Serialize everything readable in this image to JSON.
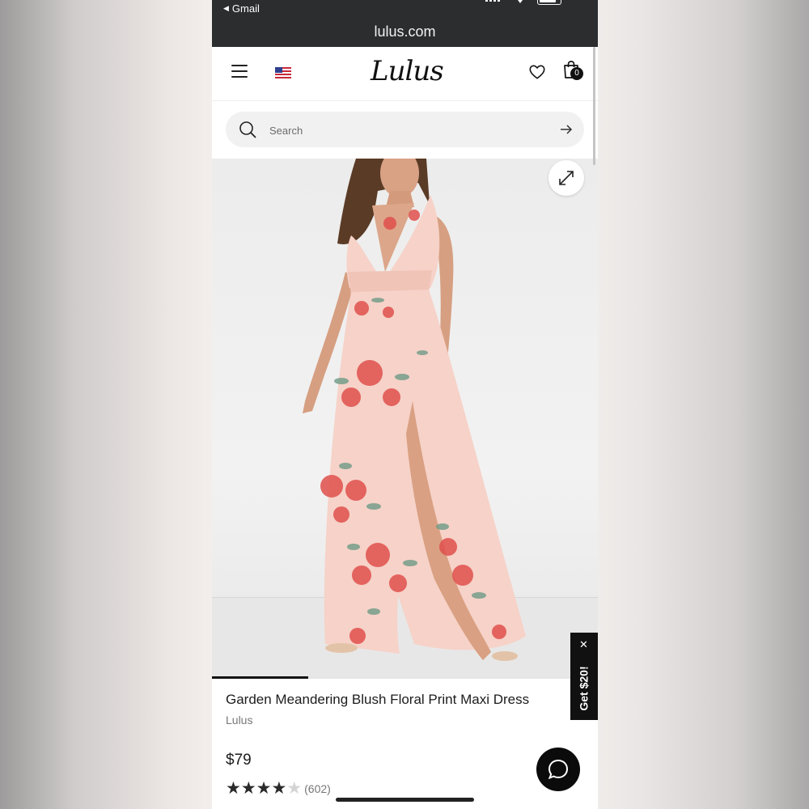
{
  "status_bar": {
    "back_app": "Gmail",
    "url": "lulus.com"
  },
  "header": {
    "logo": "Lulus",
    "cart_count": "0"
  },
  "search": {
    "placeholder": "Search"
  },
  "gallery": {
    "progress_fraction": 0.25
  },
  "product": {
    "title": "Garden Meandering Blush Floral Print Maxi Dress",
    "brand": "Lulus",
    "price": "$79",
    "rating": 4.5,
    "review_count": "(602)"
  },
  "promo": {
    "label": "Get $20!"
  },
  "colors": {
    "dark": "#111111",
    "blush": "#f6d2c8",
    "floral_red": "#e0504c",
    "leaf_green": "#6f9a86"
  }
}
